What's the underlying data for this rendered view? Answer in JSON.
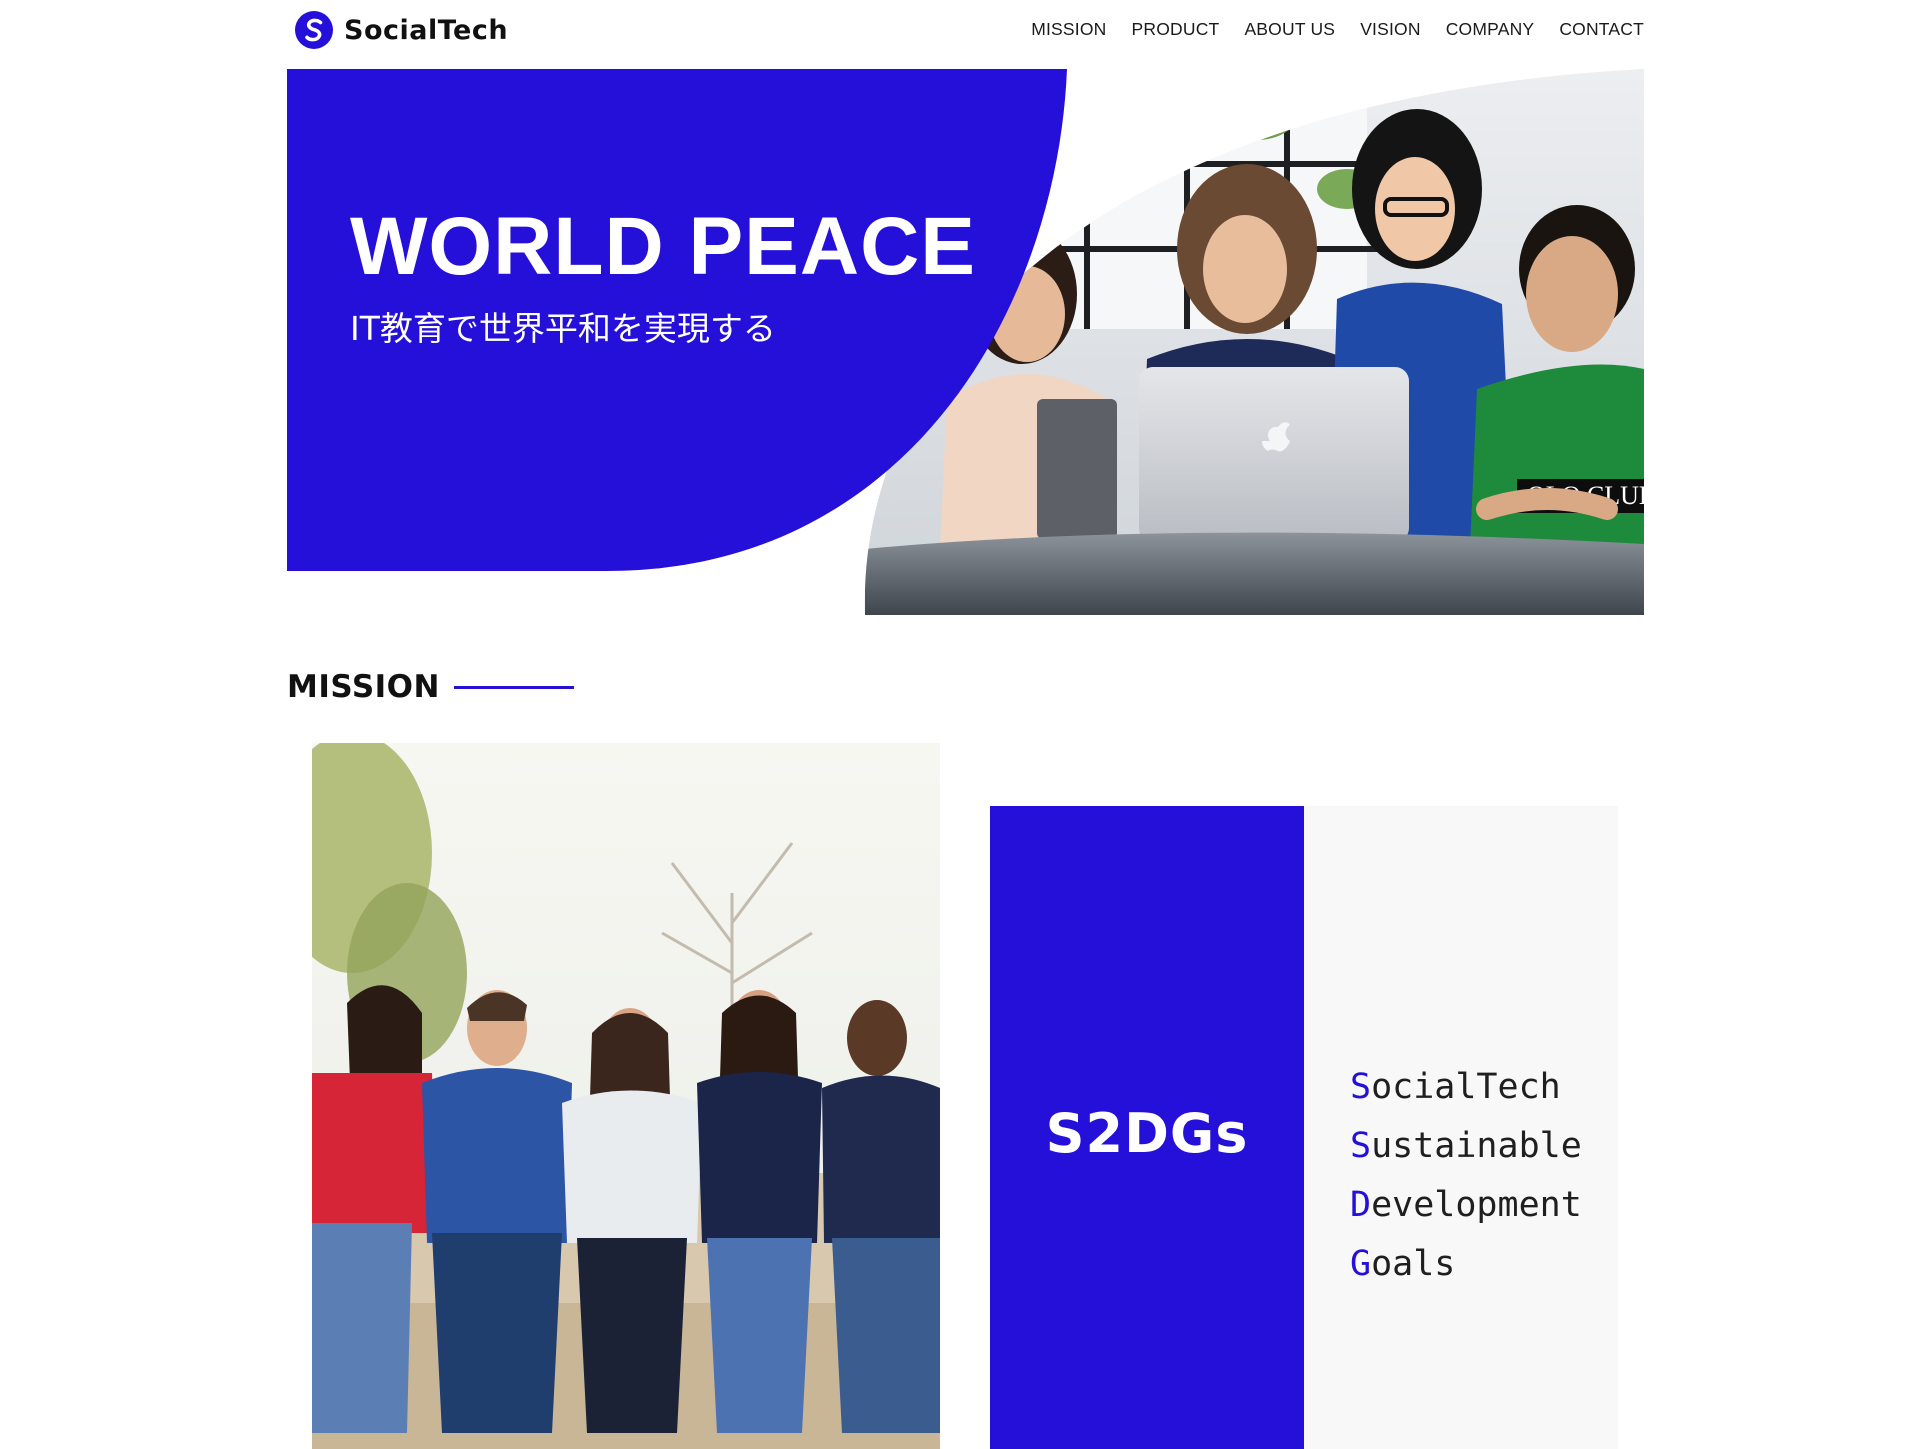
{
  "brand": {
    "name": "SocialTech",
    "accent_color": "#2410d8",
    "logo_icon": "s-letter-circle-icon"
  },
  "nav": {
    "items": [
      {
        "label": "MISSION"
      },
      {
        "label": "PRODUCT"
      },
      {
        "label": "ABOUT US"
      },
      {
        "label": "VISION"
      },
      {
        "label": "COMPANY"
      },
      {
        "label": "CONTACT"
      }
    ]
  },
  "hero": {
    "title": "WORLD PEACE",
    "subtitle": "IT教育で世界平和を実現する",
    "photo": "team-working-at-laptop-photo"
  },
  "mission": {
    "heading": "MISSION",
    "photo": "group-of-friends-sitting-photo",
    "card": {
      "title": "S2DGs",
      "lines": [
        {
          "initial": "S",
          "rest": "ocialTech"
        },
        {
          "initial": "S",
          "rest": "ustainable"
        },
        {
          "initial": "D",
          "rest": "evelopment"
        },
        {
          "initial": "G",
          "rest": "oals"
        }
      ]
    }
  }
}
